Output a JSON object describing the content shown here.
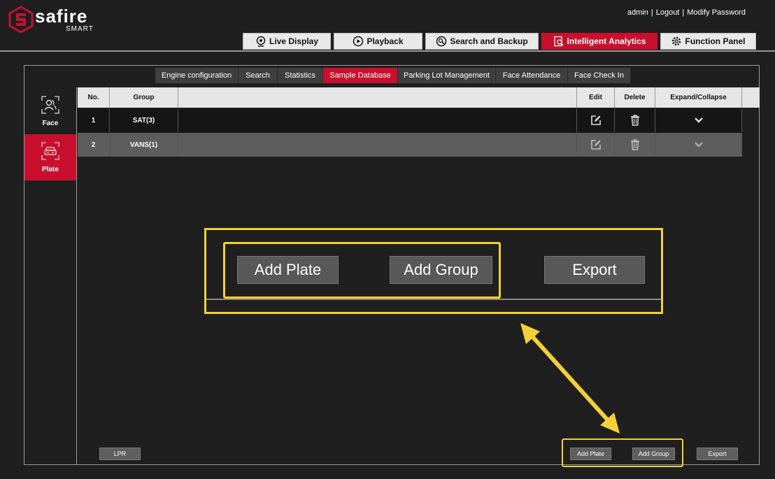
{
  "brand": {
    "name": "safire",
    "sub": "SMART",
    "color": "#c8102e"
  },
  "user_bar": {
    "user": "admin",
    "logout": "Logout",
    "modify": "Modify Password"
  },
  "main_tabs": [
    {
      "label": "Live Display",
      "icon": "webcam-icon"
    },
    {
      "label": "Playback",
      "icon": "play-icon"
    },
    {
      "label": "Search and Backup",
      "icon": "search-backup-icon"
    },
    {
      "label": "Intelligent Analytics",
      "icon": "analytics-icon",
      "active": true
    },
    {
      "label": "Function Panel",
      "icon": "gear-icon"
    }
  ],
  "sub_tabs": [
    {
      "label": "Engine configuration"
    },
    {
      "label": "Search"
    },
    {
      "label": "Statistics"
    },
    {
      "label": "Sample Database",
      "active": true
    },
    {
      "label": "Parking Lot Management"
    },
    {
      "label": "Face Attendance"
    },
    {
      "label": "Face Check In"
    }
  ],
  "left_nav": [
    {
      "label": "Face",
      "icon": "face-icon"
    },
    {
      "label": "Plate",
      "icon": "car-icon",
      "active": true
    }
  ],
  "table": {
    "headers": {
      "no": "No.",
      "group": "Group",
      "edit": "Edit",
      "delete": "Delete",
      "expand": "Expand/Collapse"
    },
    "rows": [
      {
        "no": "1",
        "group": "SAT(3)"
      },
      {
        "no": "2",
        "group": "VANS(1)"
      }
    ]
  },
  "zoom": {
    "add_plate": "Add Plate",
    "add_group": "Add Group",
    "export": "Export"
  },
  "bottom": {
    "lpr": "LPR",
    "add_plate": "Add Plate",
    "add_group": "Add Group",
    "export": "Export"
  },
  "highlight_color": "#f4cf36"
}
